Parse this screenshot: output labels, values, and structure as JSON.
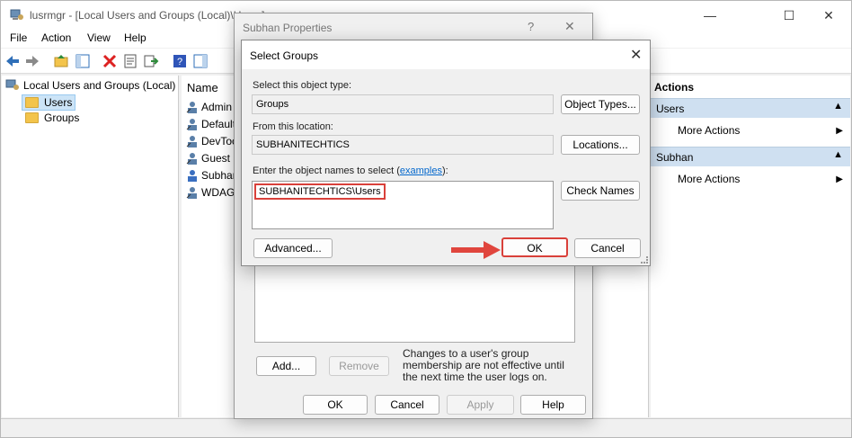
{
  "main_window": {
    "title": "lusrmgr - [Local Users and Groups (Local)\\Users]",
    "controls": {
      "minimize": "—",
      "maximize": "☐",
      "close": "✕"
    }
  },
  "menu": [
    "File",
    "Action",
    "View",
    "Help"
  ],
  "tree": {
    "root": "Local Users and Groups (Local)",
    "children": [
      "Users",
      "Groups"
    ]
  },
  "list": {
    "header": "Name",
    "rows": [
      "Admin",
      "Default",
      "DevToc",
      "Guest",
      "Subhan",
      "WDAGU"
    ]
  },
  "actions": {
    "title": "Actions",
    "groups": [
      {
        "name": "Users",
        "more": "More Actions"
      },
      {
        "name": "Subhan",
        "more": "More Actions"
      }
    ]
  },
  "properties_dialog": {
    "title": "Subhan Properties",
    "help": "?",
    "close": "✕",
    "note": "Changes to a user's group membership are not effective until the next time the user logs on.",
    "buttons": {
      "add": "Add...",
      "remove": "Remove",
      "ok": "OK",
      "cancel": "Cancel",
      "apply": "Apply",
      "help": "Help"
    }
  },
  "select_groups": {
    "title": "Select Groups",
    "close": "✕",
    "object_type_label": "Select this object type:",
    "object_type_value": "Groups",
    "object_types_button": "Object Types...",
    "location_label": "From this location:",
    "location_value": "SUBHANITECHTICS",
    "locations_button": "Locations...",
    "names_label_prefix": "Enter the object names to select (",
    "names_label_link": "examples",
    "names_label_suffix": "):",
    "names_value": "SUBHANITECHTICS\\Users",
    "check_names_button": "Check Names",
    "advanced_button": "Advanced...",
    "ok_button": "OK",
    "cancel_button": "Cancel"
  },
  "colors": {
    "highlight": "#d9403a",
    "link": "#0066cc",
    "action_group_bg": "#cfe0f1"
  }
}
